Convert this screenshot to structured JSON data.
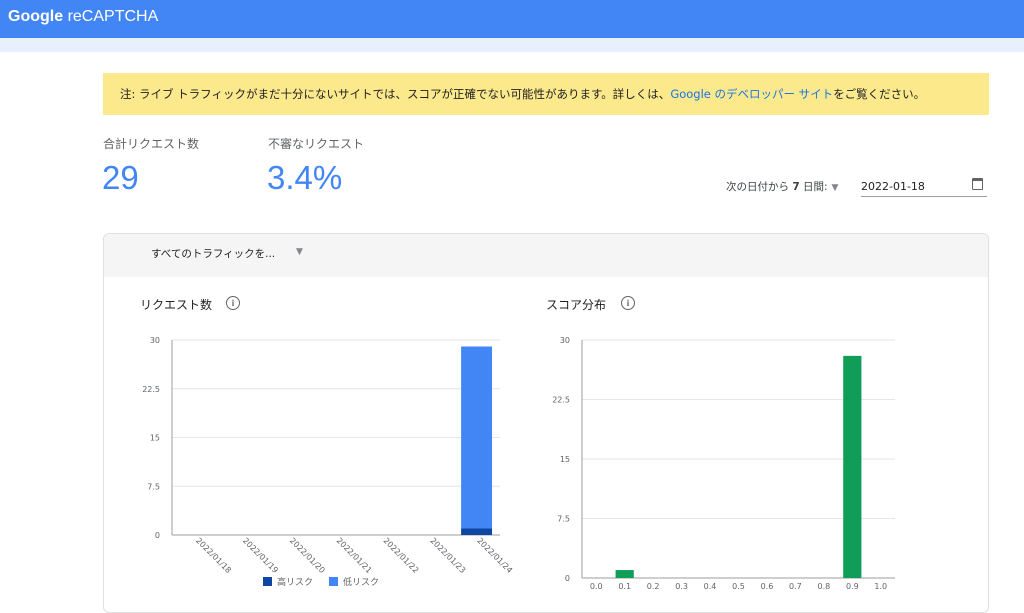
{
  "header": {
    "brand_google": "Google",
    "brand_product": "reCAPTCHA"
  },
  "notice": {
    "prefix": "注: ライブ トラフィックがまだ十分にないサイトでは、スコアが正確でない可能性があります。詳しくは、",
    "link_text": "Google のデベロッパー サイト",
    "suffix": "をご覧ください。"
  },
  "metrics": {
    "total_label": "合計リクエスト数",
    "total_value": "29",
    "suspicious_label": "不審なリクエスト",
    "suspicious_value": "3.4%"
  },
  "range": {
    "prefix": "次の日付から",
    "days": "7",
    "suffix": "日間:",
    "date": "2022-01-18"
  },
  "filter": {
    "label": "すべてのトラフィックを..."
  },
  "charts": {
    "requests_title": "リクエスト数",
    "score_title": "スコア分布"
  },
  "chart_data": [
    {
      "type": "bar",
      "title": "リクエスト数",
      "stacked": true,
      "categories": [
        "2022/01/18",
        "2022/01/19",
        "2022/01/20",
        "2022/01/21",
        "2022/01/22",
        "2022/01/23",
        "2022/01/24"
      ],
      "series": [
        {
          "name": "高リスク",
          "color": "#0d47a1",
          "values": [
            0,
            0,
            0,
            0,
            0,
            0,
            1
          ]
        },
        {
          "name": "低リスク",
          "color": "#4285f4",
          "values": [
            0,
            0,
            0,
            0,
            0,
            0,
            28
          ]
        }
      ],
      "yticks": [
        "0",
        "7.5",
        "15",
        "22.5",
        "30"
      ],
      "ylim": [
        0,
        30
      ],
      "legend": "bottom"
    },
    {
      "type": "bar",
      "title": "スコア分布",
      "categories": [
        "0.0",
        "0.1",
        "0.2",
        "0.3",
        "0.4",
        "0.5",
        "0.6",
        "0.7",
        "0.8",
        "0.9",
        "1.0"
      ],
      "series": [
        {
          "color": "#0f9d58",
          "values": [
            0,
            1,
            0,
            0,
            0,
            0,
            0,
            0,
            0,
            28,
            0
          ]
        }
      ],
      "yticks": [
        "0",
        "7.5",
        "15",
        "22.5",
        "30"
      ],
      "ylim": [
        0,
        30
      ]
    }
  ]
}
